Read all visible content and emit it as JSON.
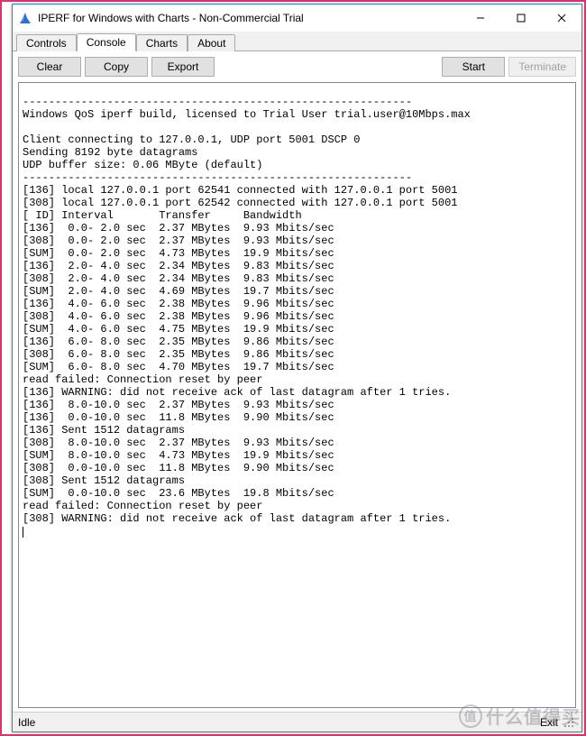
{
  "window": {
    "title": "IPERF for Windows with Charts - Non-Commercial Trial"
  },
  "tabs": [
    {
      "label": "Controls",
      "active": false
    },
    {
      "label": "Console",
      "active": true
    },
    {
      "label": "Charts",
      "active": false
    },
    {
      "label": "About",
      "active": false
    }
  ],
  "toolbar": {
    "clear": "Clear",
    "copy": "Copy",
    "export": "Export",
    "start": "Start",
    "terminate": "Terminate",
    "terminate_enabled": false
  },
  "console_lines": [
    "------------------------------------------------------------",
    "Windows QoS iperf build, licensed to Trial User trial.user@10Mbps.max",
    "",
    "Client connecting to 127.0.0.1, UDP port 5001 DSCP 0",
    "Sending 8192 byte datagrams",
    "UDP buffer size: 0.06 MByte (default)",
    "------------------------------------------------------------",
    "[136] local 127.0.0.1 port 62541 connected with 127.0.0.1 port 5001",
    "[308] local 127.0.0.1 port 62542 connected with 127.0.0.1 port 5001",
    "[ ID] Interval       Transfer     Bandwidth",
    "[136]  0.0- 2.0 sec  2.37 MBytes  9.93 Mbits/sec",
    "[308]  0.0- 2.0 sec  2.37 MBytes  9.93 Mbits/sec",
    "[SUM]  0.0- 2.0 sec  4.73 MBytes  19.9 Mbits/sec",
    "[136]  2.0- 4.0 sec  2.34 MBytes  9.83 Mbits/sec",
    "[308]  2.0- 4.0 sec  2.34 MBytes  9.83 Mbits/sec",
    "[SUM]  2.0- 4.0 sec  4.69 MBytes  19.7 Mbits/sec",
    "[136]  4.0- 6.0 sec  2.38 MBytes  9.96 Mbits/sec",
    "[308]  4.0- 6.0 sec  2.38 MBytes  9.96 Mbits/sec",
    "[SUM]  4.0- 6.0 sec  4.75 MBytes  19.9 Mbits/sec",
    "[136]  6.0- 8.0 sec  2.35 MBytes  9.86 Mbits/sec",
    "[308]  6.0- 8.0 sec  2.35 MBytes  9.86 Mbits/sec",
    "[SUM]  6.0- 8.0 sec  4.70 MBytes  19.7 Mbits/sec",
    "read failed: Connection reset by peer",
    "[136] WARNING: did not receive ack of last datagram after 1 tries.",
    "[136]  8.0-10.0 sec  2.37 MBytes  9.93 Mbits/sec",
    "[136]  0.0-10.0 sec  11.8 MBytes  9.90 Mbits/sec",
    "[136] Sent 1512 datagrams",
    "[308]  8.0-10.0 sec  2.37 MBytes  9.93 Mbits/sec",
    "[SUM]  8.0-10.0 sec  4.73 MBytes  19.9 Mbits/sec",
    "[308]  0.0-10.0 sec  11.8 MBytes  9.90 Mbits/sec",
    "[308] Sent 1512 datagrams",
    "[SUM]  0.0-10.0 sec  23.6 MBytes  19.8 Mbits/sec",
    "read failed: Connection reset by peer",
    "[308] WARNING: did not receive ack of last datagram after 1 tries."
  ],
  "status": {
    "left": "Idle",
    "right": "Exit"
  },
  "watermark": "什么值得买"
}
